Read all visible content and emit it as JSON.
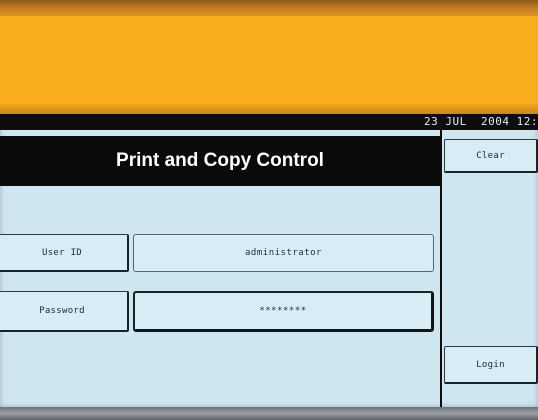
{
  "status_bar": {
    "date_time": "23 JUL  2004 12:"
  },
  "dialog": {
    "title": "Print and Copy Control",
    "user_id_label": "User ID",
    "user_id_value": "administrator",
    "password_label": "Password",
    "password_value": "********"
  },
  "side_panel": {
    "clear_label": "Clear",
    "login_label": "Login"
  }
}
